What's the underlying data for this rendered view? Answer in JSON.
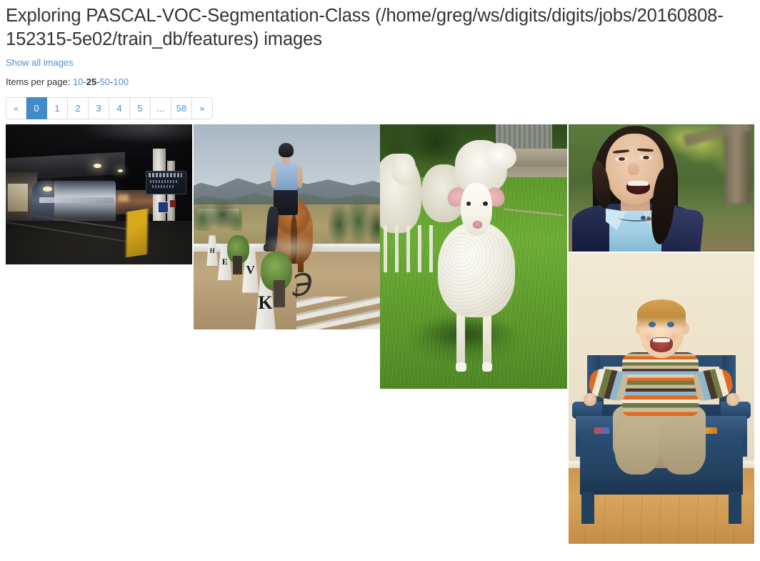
{
  "header": {
    "title": "Exploring PASCAL-VOC-Segmentation-Class (/home/greg/ws/digits/digits/jobs/20160808-152315-5e02/train_db/features) images",
    "show_all_link": "Show all images"
  },
  "items_per_page": {
    "label": "Items per page:",
    "separator": "-",
    "options": [
      "10",
      "25",
      "50",
      "100"
    ],
    "selected": "25"
  },
  "pagination": {
    "prev_label": "«",
    "next_label": "»",
    "ellipsis": "...",
    "pages": [
      "0",
      "1",
      "2",
      "3",
      "4",
      "5"
    ],
    "last_page": "58",
    "active_page": "0"
  },
  "colors": {
    "link": "#4a90d9",
    "active_page_bg": "#428bca",
    "active_page_text": "#ffffff",
    "border": "#dddddd",
    "text": "#333333",
    "background": "#ffffff"
  },
  "gallery": {
    "images": [
      {
        "name": "train-night-station",
        "alt": "Amtrak train at a dark night railway station platform with yellow safety line"
      },
      {
        "name": "horse-rider-dressage",
        "alt": "Rider on a brown horse in a dressage arena with H E V K letter markers and mountains"
      },
      {
        "name": "sheep-flock-field",
        "alt": "White lamb standing in green grass with flock of sheep and fence behind"
      },
      {
        "name": "woman-portrait-outdoors",
        "alt": "Smiling woman with dark hair in navy jacket and light blue shirt outdoors"
      },
      {
        "name": "baby-on-blue-bench",
        "alt": "Smiling baby in striped sweater sitting on a dark blue wooden bench"
      }
    ]
  },
  "markers": {
    "dressage_letters": [
      "H",
      "E",
      "V",
      "K"
    ],
    "signature_glyph": "℈",
    "signature_glyph2": "ƒ"
  }
}
